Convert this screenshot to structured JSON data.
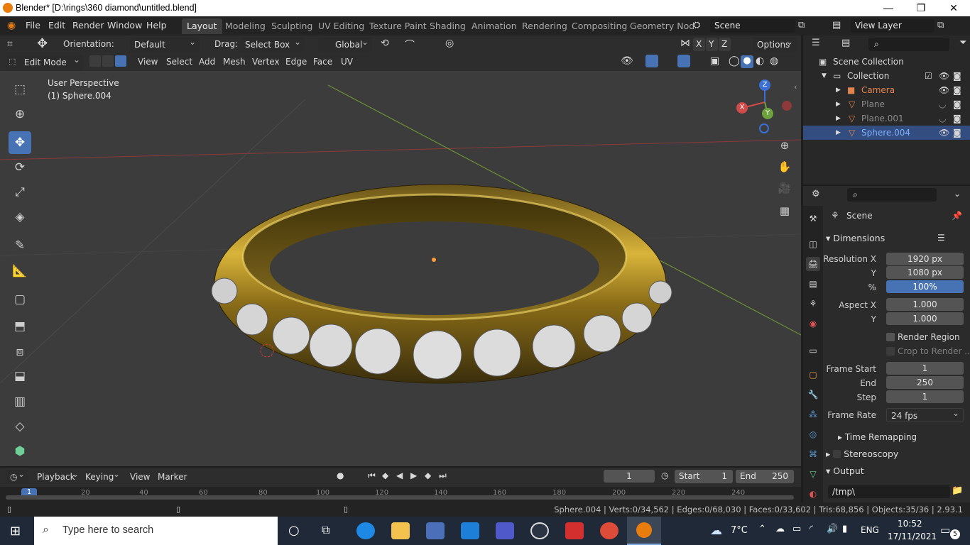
{
  "window": {
    "title": "Blender* [D:\\rings\\360 diamond\\untitled.blend]",
    "controls": {
      "minimize": "—",
      "maximize": "❐",
      "close": "✕"
    }
  },
  "menu": [
    "File",
    "Edit",
    "Render",
    "Window",
    "Help"
  ],
  "workspaces": [
    "Layout",
    "Modeling",
    "Sculpting",
    "UV Editing",
    "Texture Paint",
    "Shading",
    "Animation",
    "Rendering",
    "Compositing",
    "Geometry Nod"
  ],
  "scene": {
    "name": "Scene",
    "view_layer": "View Layer"
  },
  "tool_header": {
    "orientation_label": "Orientation:",
    "orientation_value": "Default",
    "drag_label": "Drag:",
    "drag_value": "Select Box",
    "transform_value": "Global",
    "axes": [
      "X",
      "Y",
      "Z"
    ],
    "options": "Options"
  },
  "editor_header": {
    "mode": "Edit Mode",
    "menus": [
      "View",
      "Select",
      "Add",
      "Mesh",
      "Vertex",
      "Edge",
      "Face",
      "UV"
    ]
  },
  "viewport": {
    "perspective": "User Perspective",
    "object": "(1) Sphere.004",
    "gizmo": {
      "x": "X",
      "y": "Y",
      "z": "Z"
    }
  },
  "outliner": {
    "root": "Scene Collection",
    "collection": "Collection",
    "items": [
      {
        "name": "Camera",
        "color": "#e0844f"
      },
      {
        "name": "Plane",
        "color": "#8a8a8a"
      },
      {
        "name": "Plane.001",
        "color": "#8a8a8a"
      },
      {
        "name": "Sphere.004",
        "color": "#7fb0ff"
      }
    ]
  },
  "properties": {
    "context": "Scene",
    "dimensions_title": "Dimensions",
    "resolution_x_label": "Resolution X",
    "resolution_x": "1920 px",
    "resolution_y_label": "Y",
    "resolution_y": "1080 px",
    "percent_label": "%",
    "percent": "100%",
    "aspect_x_label": "Aspect X",
    "aspect_x": "1.000",
    "aspect_y_label": "Y",
    "aspect_y": "1.000",
    "render_region": "Render Region",
    "crop": "Crop to Render ...",
    "frame_start_label": "Frame Start",
    "frame_start": "1",
    "end_label": "End",
    "end": "250",
    "step_label": "Step",
    "step": "1",
    "frame_rate_label": "Frame Rate",
    "frame_rate": "24 fps",
    "time_remapping": "Time Remapping",
    "stereoscopy": "Stereoscopy",
    "output_title": "Output",
    "output_path": "/tmp\\"
  },
  "timeline": {
    "menus": [
      "Playback",
      "Keying",
      "View",
      "Marker"
    ],
    "current_frame": "1",
    "start_label": "Start",
    "start": "1",
    "end_label": "End",
    "end": "250",
    "ruler": [
      "1",
      "20",
      "40",
      "60",
      "80",
      "100",
      "120",
      "140",
      "160",
      "180",
      "200",
      "220",
      "240"
    ]
  },
  "status": {
    "text": "Sphere.004 | Verts:0/34,562 | Edges:0/68,030 | Faces:0/33,602 | Tris:68,856 | Objects:35/36 | 2.93.1"
  },
  "taskbar": {
    "search_placeholder": "Type here to search",
    "temperature": "7°C",
    "lang": "ENG",
    "time": "10:52",
    "date": "17/11/2021",
    "notifications": "5"
  }
}
